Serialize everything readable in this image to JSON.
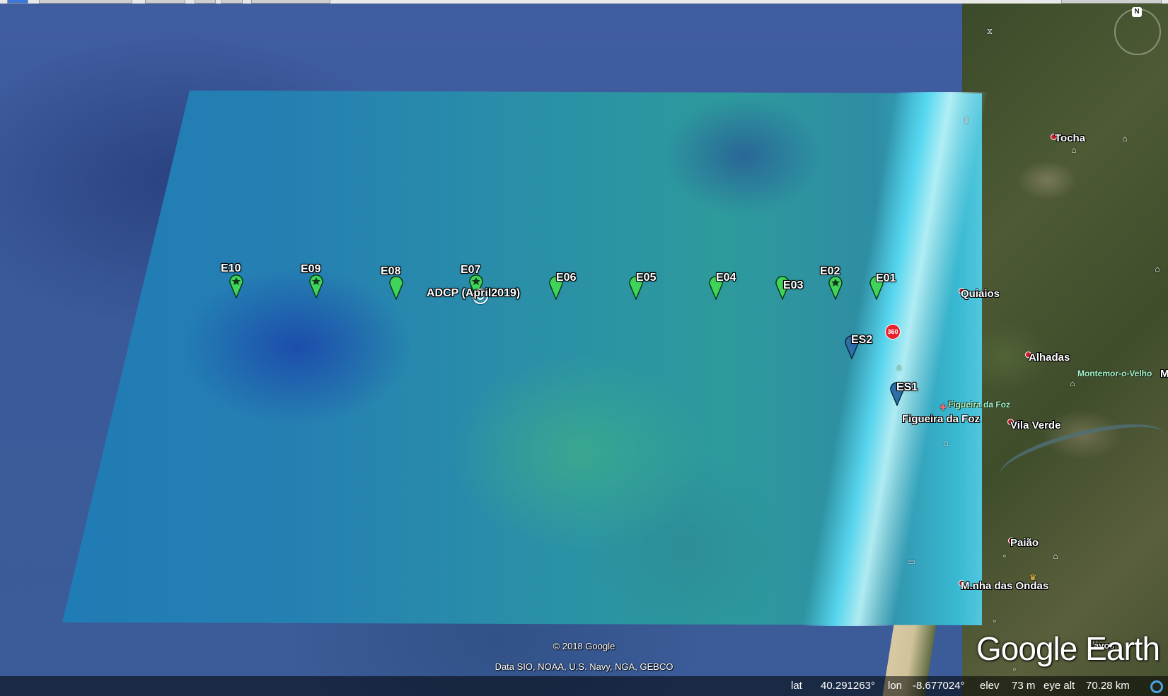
{
  "markers": [
    {
      "id": "E10",
      "label": "E10",
      "style": "green-star"
    },
    {
      "id": "E09",
      "label": "E09",
      "style": "green-star"
    },
    {
      "id": "E08",
      "label": "E08",
      "style": "green"
    },
    {
      "id": "E07",
      "label": "E07",
      "style": "green-star"
    },
    {
      "id": "E06",
      "label": "E06",
      "style": "green"
    },
    {
      "id": "E05",
      "label": "E05",
      "style": "green"
    },
    {
      "id": "E04",
      "label": "E04",
      "style": "green"
    },
    {
      "id": "E03",
      "label": "E03",
      "style": "green"
    },
    {
      "id": "E02",
      "label": "E02",
      "style": "green-star"
    },
    {
      "id": "E01",
      "label": "E01",
      "style": "green"
    },
    {
      "id": "ES2",
      "label": "ES2",
      "style": "blue"
    },
    {
      "id": "ES1",
      "label": "ES1",
      "style": "blue"
    }
  ],
  "adcp": {
    "label": "ADCP (April2019)"
  },
  "places": {
    "tocha": "Tocha",
    "quiaios": "Quiaios",
    "alhadas": "Alhadas",
    "montemor": "Montemor-o-Velho",
    "montemor_cut": "M",
    "figueira_small": "Figueira da Foz",
    "figueira": "Figueira da Foz",
    "vila_verde": "Vila Verde",
    "paiao": "Paião",
    "marinha": "M.nha das Ondas",
    "lavos": "Lavos"
  },
  "badge_360": "360",
  "compass_label": "N",
  "copyright": "© 2018 Google",
  "data_credit": "Data SIO, NOAA, U.S. Navy, NGA, GEBCO",
  "logo": "Google Earth",
  "status": {
    "lat_label": "lat",
    "lat_value": "40.291263°",
    "lon_label": "lon",
    "lon_value": "-8.677024°",
    "elev_label": "elev",
    "elev_value": "73 m",
    "eye_alt_label": "eye alt",
    "eye_alt_value": "70.28 km"
  },
  "colors": {
    "pin_green": "#3fd45a",
    "pin_blue": "#2e6fa8",
    "place_dot": "#d21a2a",
    "badge_red": "#e8212b"
  }
}
